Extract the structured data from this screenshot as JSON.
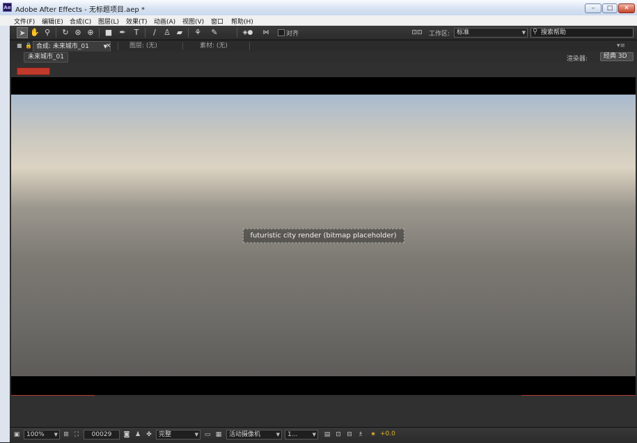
{
  "window": {
    "title": "Adobe After Effects - 无标题项目.aep *",
    "app_icon": "Ae"
  },
  "menubar": {
    "items": [
      "文件(F)",
      "编辑(E)",
      "合成(C)",
      "图层(L)",
      "效果(T)",
      "动画(A)",
      "视图(V)",
      "窗口",
      "帮助(H)"
    ]
  },
  "toolbar": {
    "snap_label": "对齐",
    "workspace_label": "工作区:",
    "workspace_value": "标准",
    "search_placeholder": "搜索帮助"
  },
  "panel_tabs": {
    "composition_tab": "合成: 未来城市_01",
    "layer_tab": "图层: (无)",
    "footage_tab": "素材: (无)"
  },
  "comp_bar": {
    "breadcrumb": "未来城市_01",
    "renderer_label": "渲染器:",
    "renderer_value": "经典 3D"
  },
  "viewer": {
    "scene_description": "futuristic city render (bitmap placeholder)",
    "accent_color": "#c0392b"
  },
  "bottom_bar": {
    "zoom": "100%",
    "timecode": "00029",
    "resolution": "完整",
    "camera": "活动摄像机",
    "views": "1...",
    "exposure": "+0.0"
  },
  "icons": {
    "selection": "selection-tool-icon",
    "hand": "hand-tool-icon",
    "zoom": "zoom-tool-icon",
    "rotate": "rotate-tool-icon",
    "search": "search-icon"
  }
}
